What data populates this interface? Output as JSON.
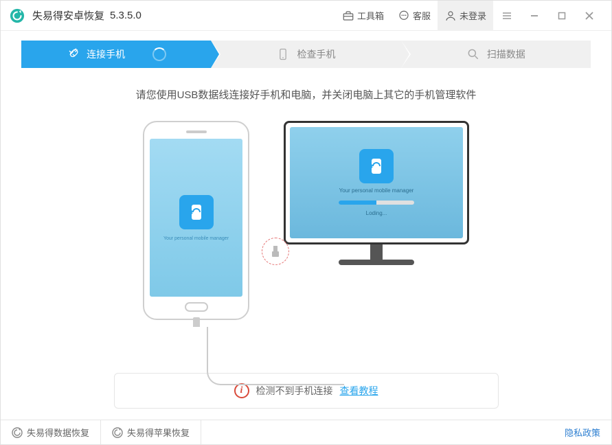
{
  "header": {
    "app_name": "失易得安卓恢复",
    "version": "5.3.5.0",
    "toolbox_label": "工具箱",
    "support_label": "客服",
    "login_label": "未登录"
  },
  "steps": {
    "step1": "连接手机",
    "step2": "检查手机",
    "step3": "扫描数据"
  },
  "main": {
    "instruction": "请您使用USB数据线连接好手机和电脑，并关闭电脑上其它的手机管理软件",
    "phone_app_text": "Your personal mobile manager",
    "monitor_app_text": "Your personal mobile manager",
    "loading_text": "Loding..."
  },
  "status": {
    "message": "检测不到手机连接",
    "link_text": "查看教程"
  },
  "footer": {
    "data_recovery": "失易得数据恢复",
    "apple_recovery": "失易得苹果恢复",
    "privacy_policy": "隐私政策"
  }
}
